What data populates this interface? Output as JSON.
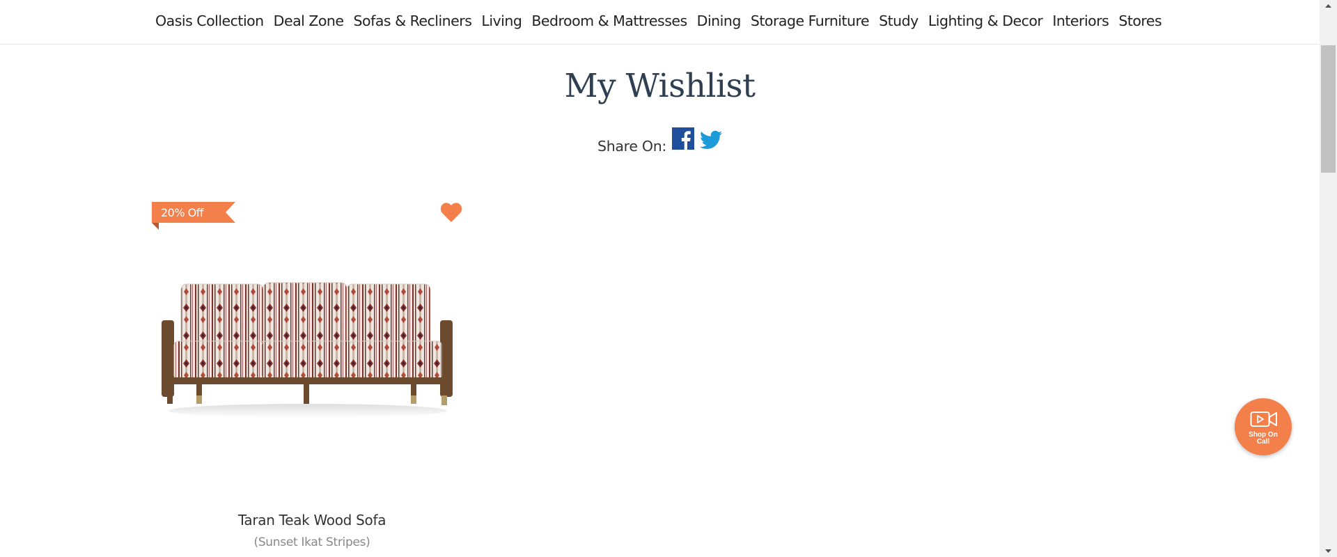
{
  "nav": {
    "items": [
      {
        "label": "Oasis Collection"
      },
      {
        "label": "Deal Zone"
      },
      {
        "label": "Sofas & Recliners"
      },
      {
        "label": "Living"
      },
      {
        "label": "Bedroom & Mattresses"
      },
      {
        "label": "Dining"
      },
      {
        "label": "Storage Furniture"
      },
      {
        "label": "Study"
      },
      {
        "label": "Lighting & Decor"
      },
      {
        "label": "Interiors"
      },
      {
        "label": "Stores"
      }
    ]
  },
  "page": {
    "title": "My Wishlist",
    "share_label": "Share On:",
    "share_icons": [
      "facebook-icon",
      "twitter-icon"
    ]
  },
  "wishlist": {
    "items": [
      {
        "discount": "20% Off",
        "name": "Taran Teak Wood Sofa",
        "variant": "(Sunset Ikat Stripes)",
        "wishlisted": true
      }
    ]
  },
  "floating": {
    "shop_on_call_label_line1": "Shop On",
    "shop_on_call_label_line2": "Call",
    "icon": "video-camera-icon"
  },
  "colors": {
    "accent": "#f37f4a",
    "title": "#2d3f50",
    "facebook": "#1f4f9c",
    "twitter": "#1d9bd9"
  }
}
